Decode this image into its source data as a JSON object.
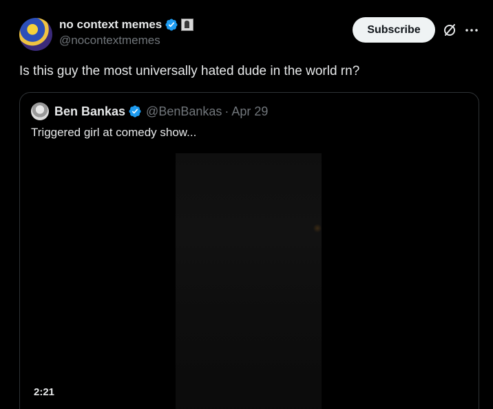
{
  "author": {
    "display_name": "no context memes",
    "handle": "@nocontextmemes",
    "verified_color": "#1d9bf0"
  },
  "actions": {
    "subscribe_label": "Subscribe",
    "grok_icon": "grok-icon",
    "more_icon": "more-icon"
  },
  "tweet": {
    "text": "Is this guy the most universally hated dude in the world rn?"
  },
  "quote": {
    "display_name": "Ben Bankas",
    "handle": "@BenBankas",
    "separator": "·",
    "date": "Apr 29",
    "text": "Triggered girl at comedy show...",
    "video": {
      "duration": "2:21"
    }
  }
}
